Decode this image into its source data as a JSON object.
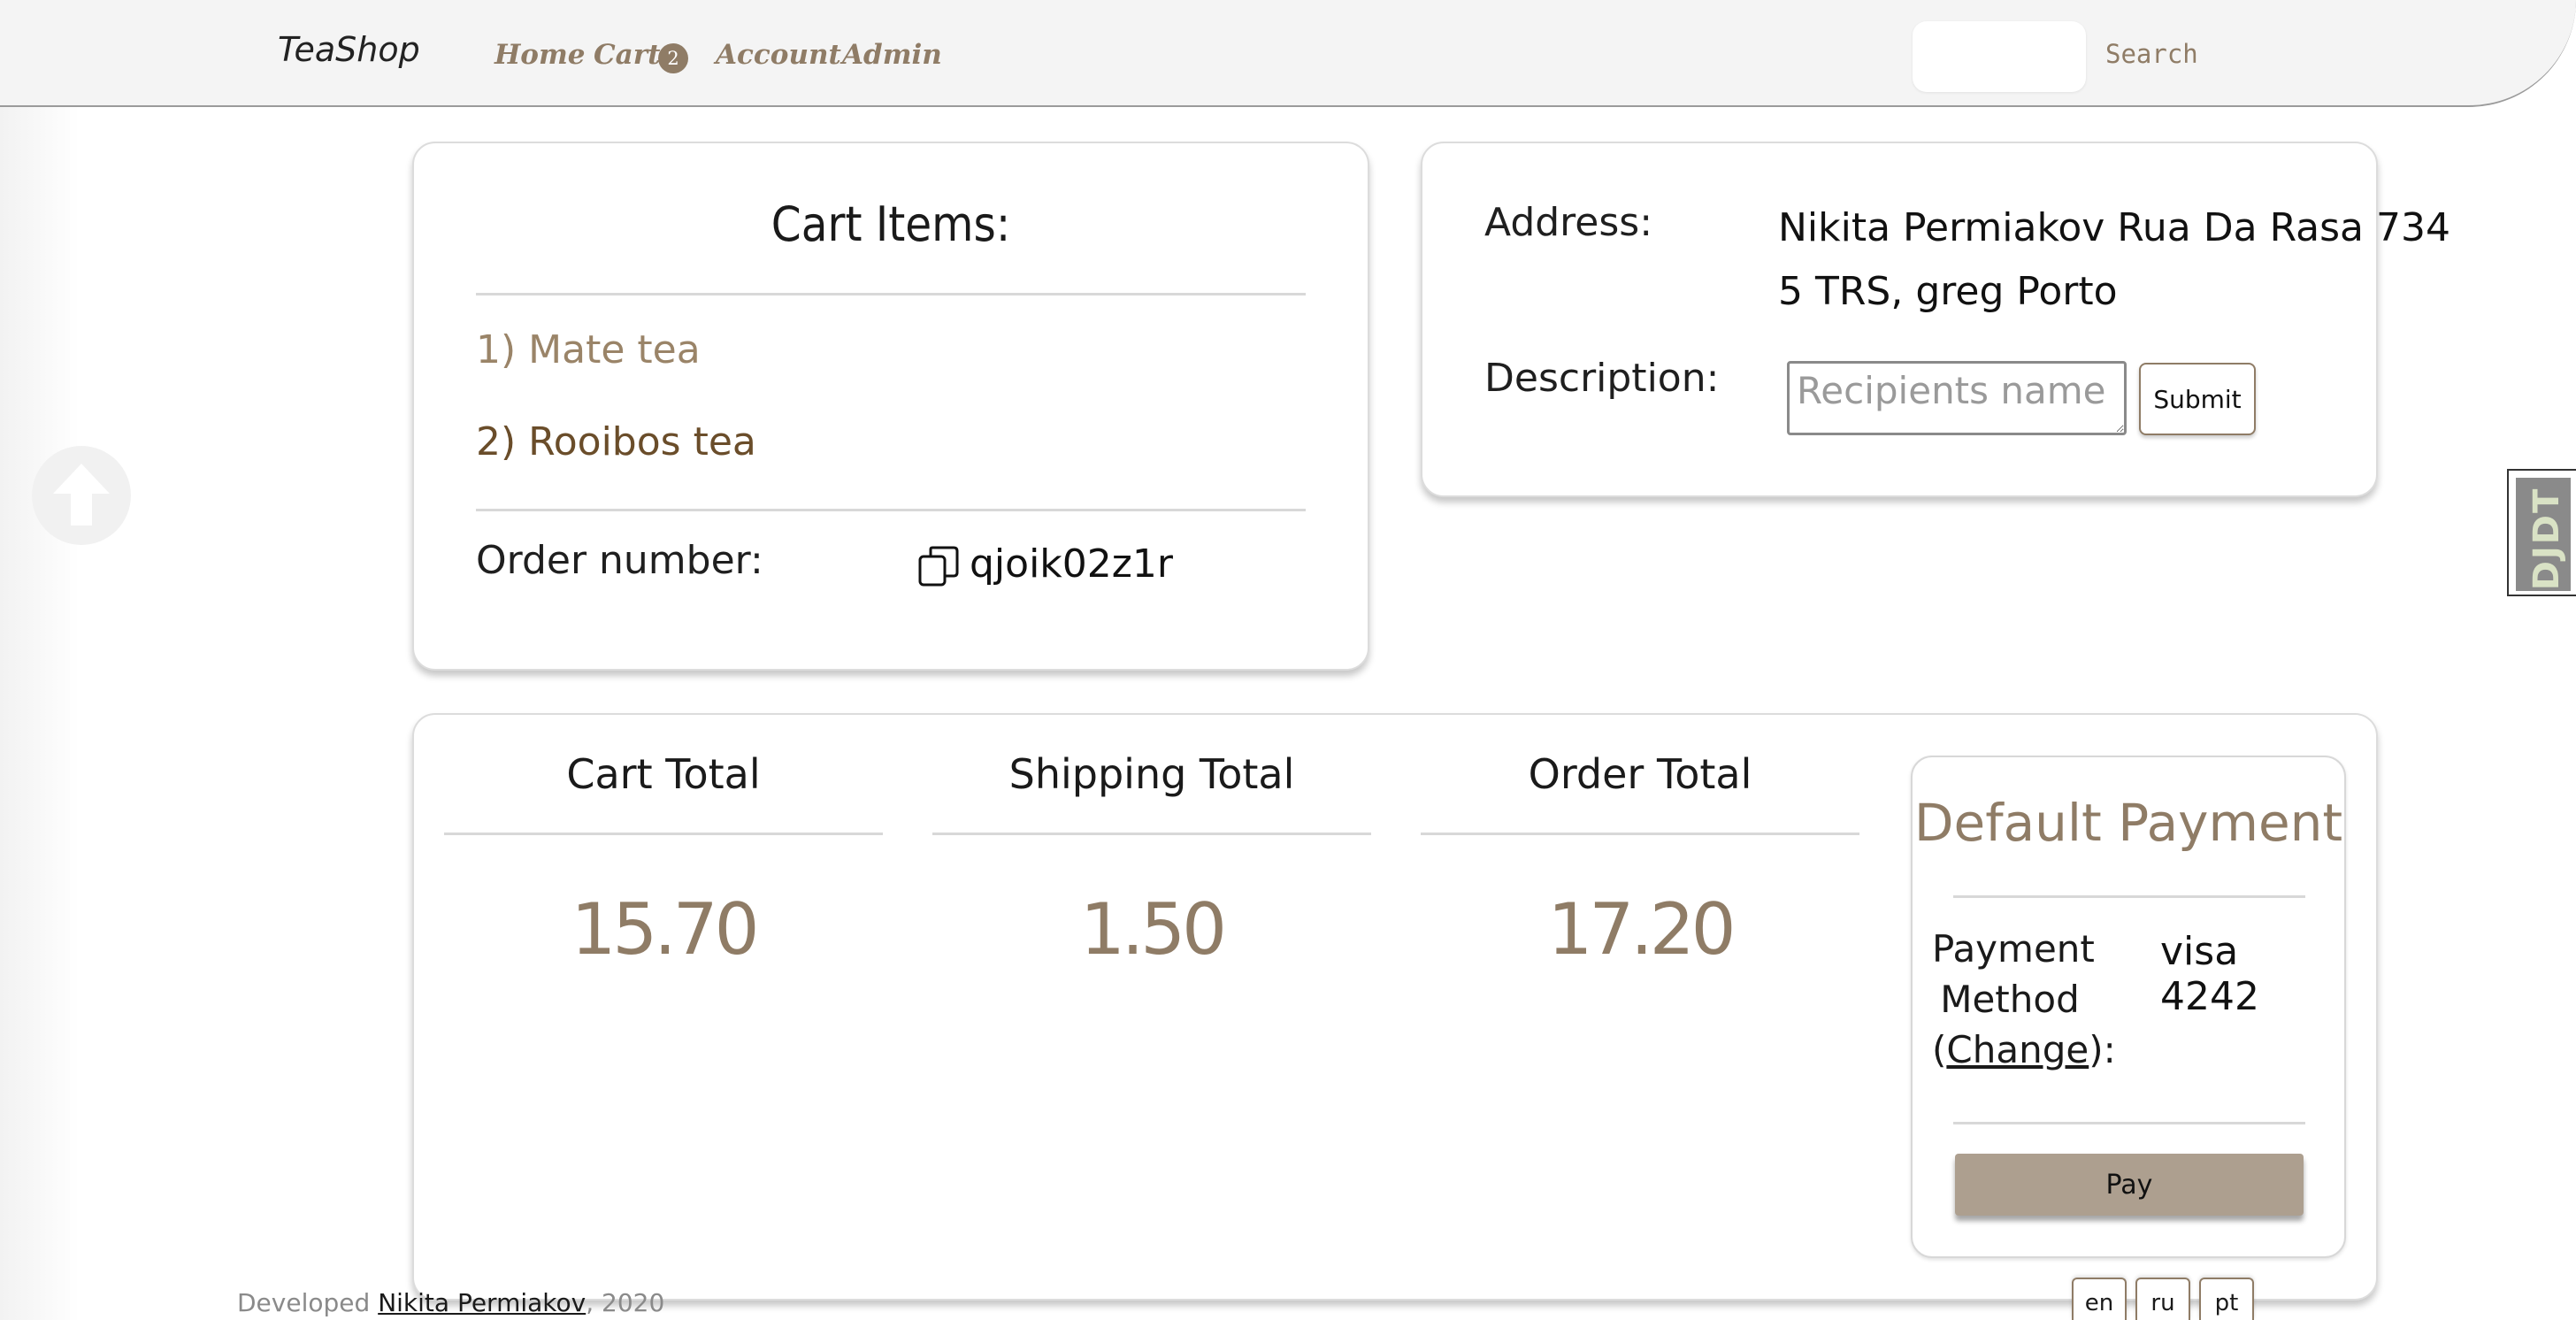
{
  "nav": {
    "brand": "TeaShop",
    "home": "Home",
    "cart": "Cart",
    "cart_count": "2",
    "account": "Account",
    "admin": "Admin",
    "search_value": "",
    "search_button": "Search"
  },
  "cart_card": {
    "title": "Cart Items:",
    "items": [
      "1) Mate tea",
      "2) Rooibos tea"
    ],
    "order_number_label": "Order number:",
    "order_number": "qjoik02z1r"
  },
  "address_card": {
    "address_label": "Address:",
    "address_line1": "Nikita Permiakov Rua Da Rasa 734",
    "address_line2": "5 TRS, greg Porto",
    "description_label": "Description:",
    "description_placeholder": "Recipients name",
    "submit": "Submit"
  },
  "totals": {
    "cart_total_label": "Cart Total",
    "cart_total": "15.70",
    "shipping_total_label": "Shipping Total",
    "shipping_total": "1.50",
    "order_total_label": "Order Total",
    "order_total": "17.20"
  },
  "payment": {
    "title": "Default Payment",
    "method_label_1": "Payment",
    "method_label_2": "Method",
    "change": "Change",
    "method_value": "visa 4242",
    "pay": "Pay"
  },
  "footer": {
    "developed": "Developed",
    "author": "Nikita Permiakov",
    "year": ", 2020",
    "languages": [
      "en",
      "ru",
      "pt"
    ]
  },
  "debug_toolbar": {
    "label": "DJDT"
  },
  "colors": {
    "accent": "#8f7c66",
    "pay_button": "#ad9f8f",
    "item_1": "#9a8468",
    "item_2": "#6a4d2a"
  }
}
